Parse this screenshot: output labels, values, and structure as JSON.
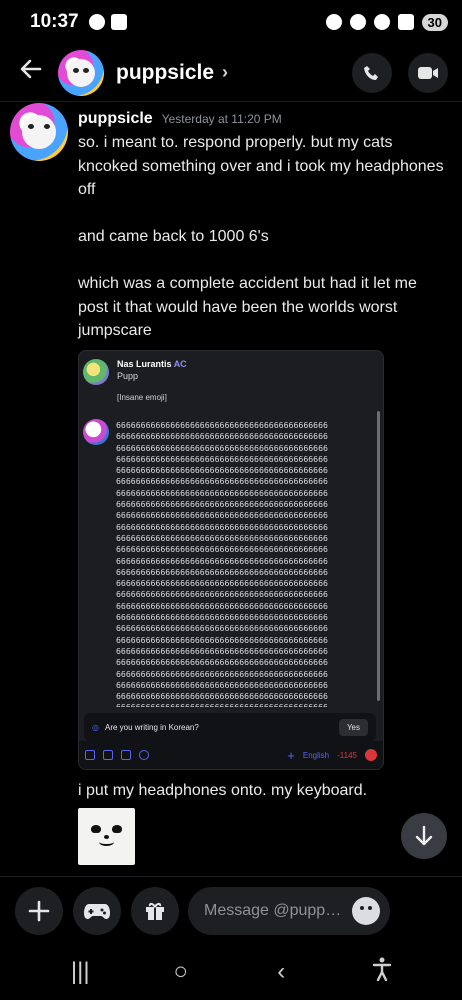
{
  "status_bar": {
    "time": "10:37",
    "battery": "30"
  },
  "header": {
    "back_icon": "arrow-left-icon",
    "channel_name": "puppsicle",
    "chevron": "›",
    "call_icon": "phone-call-icon",
    "video_icon": "video-camera-icon"
  },
  "message": {
    "author": "puppsicle",
    "timestamp": "Yesterday at 11:20 PM",
    "paragraphs": [
      "so. i meant to. respond properly. but my cats kncoked something over and i took my headphones off",
      "and came back to 1000 6's",
      "which was a complete accident but had it let me post it that would have been the worlds worst jumpscare"
    ],
    "attachment": {
      "user1_name": "Nas Lurantis",
      "user1_tag": "AC",
      "user1_sub": "Pupp",
      "user1_msg": "[Insane emoji]",
      "sixes_line": "6666666666666666666666666666666666666666666",
      "korean_prompt": "Are you writing in Korean?",
      "yes_label": "Yes",
      "language": "English",
      "char_count": "-1145"
    },
    "followup": "i put my headphones onto. my keyboard."
  },
  "composer": {
    "placeholder": "Message @pupp…",
    "plus_icon": "plus-icon",
    "gamepad_icon": "gamepad-icon",
    "gift_icon": "gift-icon",
    "emoji_icon": "emoji-icon"
  },
  "navbar": {
    "recents": "|||",
    "home": "○",
    "back": "‹",
    "accessibility_icon": "accessibility-icon"
  },
  "colors": {
    "background": "#000000",
    "surface": "#1e1f22",
    "accent": "#5865f2",
    "danger": "#da373c"
  }
}
